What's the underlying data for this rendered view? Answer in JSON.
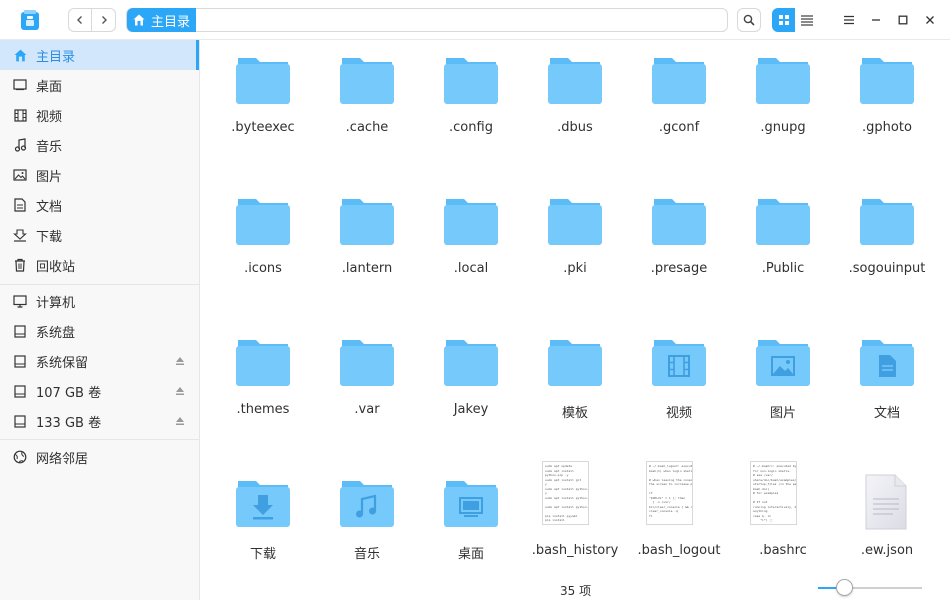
{
  "titlebar": {
    "breadcrumb": "主目录",
    "icons": [
      "file-manager-logo",
      "back-arrow",
      "forward-arrow",
      "search-icon",
      "grid-view-icon",
      "list-view-icon",
      "menu-icon",
      "minimize-icon",
      "maximize-icon",
      "close-icon"
    ]
  },
  "sidebar": {
    "items": [
      {
        "label": "主目录",
        "icon": "home-icon",
        "active": true
      },
      {
        "label": "桌面",
        "icon": "desktop-icon"
      },
      {
        "label": "视频",
        "icon": "video-icon"
      },
      {
        "label": "音乐",
        "icon": "music-icon"
      },
      {
        "label": "图片",
        "icon": "picture-icon"
      },
      {
        "label": "文档",
        "icon": "document-icon"
      },
      {
        "label": "下载",
        "icon": "download-icon"
      },
      {
        "label": "回收站",
        "icon": "trash-icon"
      },
      {
        "label": "计算机",
        "icon": "computer-icon"
      },
      {
        "label": "系统盘",
        "icon": "disk-icon"
      },
      {
        "label": "系统保留",
        "icon": "disk-icon",
        "eject": true
      },
      {
        "label": "107 GB 卷",
        "icon": "disk-icon",
        "eject": true
      },
      {
        "label": "133 GB 卷",
        "icon": "disk-icon",
        "eject": true
      },
      {
        "label": "网络邻居",
        "icon": "network-icon"
      }
    ]
  },
  "files": [
    {
      "name": ".byteexec",
      "type": "folder"
    },
    {
      "name": ".cache",
      "type": "folder"
    },
    {
      "name": ".config",
      "type": "folder"
    },
    {
      "name": ".dbus",
      "type": "folder"
    },
    {
      "name": ".gconf",
      "type": "folder"
    },
    {
      "name": ".gnupg",
      "type": "folder"
    },
    {
      "name": ".gphoto",
      "type": "folder"
    },
    {
      "name": ".icons",
      "type": "folder"
    },
    {
      "name": ".lantern",
      "type": "folder"
    },
    {
      "name": ".local",
      "type": "folder"
    },
    {
      "name": ".pki",
      "type": "folder"
    },
    {
      "name": ".presage",
      "type": "folder"
    },
    {
      "name": ".Public",
      "type": "folder"
    },
    {
      "name": ".sogouinput",
      "type": "folder"
    },
    {
      "name": ".themes",
      "type": "folder"
    },
    {
      "name": ".var",
      "type": "folder"
    },
    {
      "name": "Jakey",
      "type": "folder"
    },
    {
      "name": "模板",
      "type": "folder"
    },
    {
      "name": "视频",
      "type": "folder-video"
    },
    {
      "name": "图片",
      "type": "folder-picture"
    },
    {
      "name": "文档",
      "type": "folder-document"
    },
    {
      "name": "下载",
      "type": "folder-download"
    },
    {
      "name": "音乐",
      "type": "folder-music"
    },
    {
      "name": "桌面",
      "type": "folder-desktop"
    },
    {
      "name": ".bash_history",
      "type": "text"
    },
    {
      "name": ".bash_logout",
      "type": "text"
    },
    {
      "name": ".bashrc",
      "type": "text"
    },
    {
      "name": ".ew.json",
      "type": "json"
    }
  ],
  "thumbs": {
    "bash_history": "sudo apt update\nsudo apt install\npython-pip -y\nsudo apt install git\ny\nsudo apt install python-serial\ny\nsudo apt install python-usb -y\n\nsudo apt install python-usb -y\n\npip install pyyaml\npip install\npyyaml",
    "bash_logout": "# ~/.bash_logout: executed by\nbash(1) when login shell exits.\n\n# when leaving the console clear\nthe screen to increase privacy\n\nif\n\"$SHLVL\" = 1 ]; then\n  [ -x /usr/\nbin/clear_console ] && /usr/bin/\nclear_console -q\nfi",
    "bashrc": "# ~/.bashrc: executed by bash(1)\nfor non-login shells.\n# see /usr/\nshare/doc/bash/examples/\nstartup-files (in the package\nbash-doc)\n# for examples\n\n# If not\nrunning interactively, don't do\nanything\ncase $- in\n    *i*) ;;\n      *) ..."
  },
  "status": {
    "count": "35 项",
    "zoom_level": 0.25
  },
  "colors": {
    "accent": "#2ca7f8",
    "folder": "#76c9fb",
    "folder_back": "#5bbcf7"
  }
}
